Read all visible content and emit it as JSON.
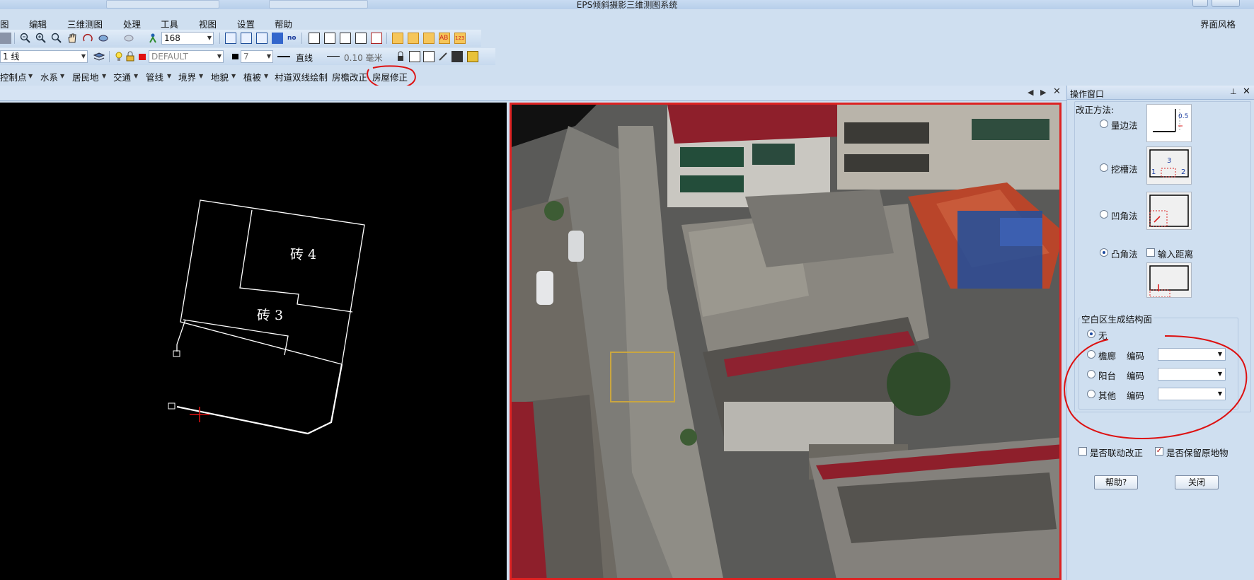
{
  "app": {
    "title": "EPS倾斜摄影三维测图系统"
  },
  "menu": {
    "items": [
      "图",
      "编辑",
      "三维测图",
      "处理",
      "工具",
      "视图",
      "设置",
      "帮助"
    ],
    "style_label": "界面风格"
  },
  "toolbar1": {
    "scale_value": "168"
  },
  "toolbar2": {
    "layer_value": "1 线",
    "color_value": "DEFAULT",
    "width_value": "7",
    "line_type": "直线",
    "line_width": "0.10 毫米"
  },
  "features": {
    "items": [
      "控制点",
      "水系",
      "居民地",
      "交通",
      "管线",
      "境界",
      "地貌",
      "植被",
      "村道双线绘制",
      "房檐改正",
      "房屋修正"
    ]
  },
  "cad": {
    "labels": [
      "砖 4",
      "砖 3"
    ]
  },
  "panel": {
    "title": "操作窗口",
    "method_label": "改正方法:",
    "methods": [
      {
        "label": "量边法",
        "selected": false
      },
      {
        "label": "挖槽法",
        "selected": false
      },
      {
        "label": "凹角法",
        "selected": false
      },
      {
        "label": "凸角法",
        "selected": true
      }
    ],
    "input_distance_label": "输入距离",
    "thumb_texts": {
      "measure": "0.5",
      "groove_top": "3",
      "groove_left": "1",
      "groove_right": "2"
    },
    "blank_area_title": "空白区生成结构面",
    "blank_options": [
      {
        "label": "无",
        "selected": true
      },
      {
        "label": "檐廊",
        "code_label": "编码",
        "selected": false
      },
      {
        "label": "阳台",
        "code_label": "编码",
        "selected": false
      },
      {
        "label": "其他",
        "code_label": "编码",
        "selected": false
      }
    ],
    "linked_fix_label": "是否联动改正",
    "keep_original_label": "是否保留原地物",
    "keep_original_checked": true,
    "help_button": "帮助?",
    "close_button": "关闭"
  },
  "colors": {
    "accent_red": "#dd1111",
    "panel_bg": "#cfdff0",
    "canvas_bg": "#000000"
  }
}
